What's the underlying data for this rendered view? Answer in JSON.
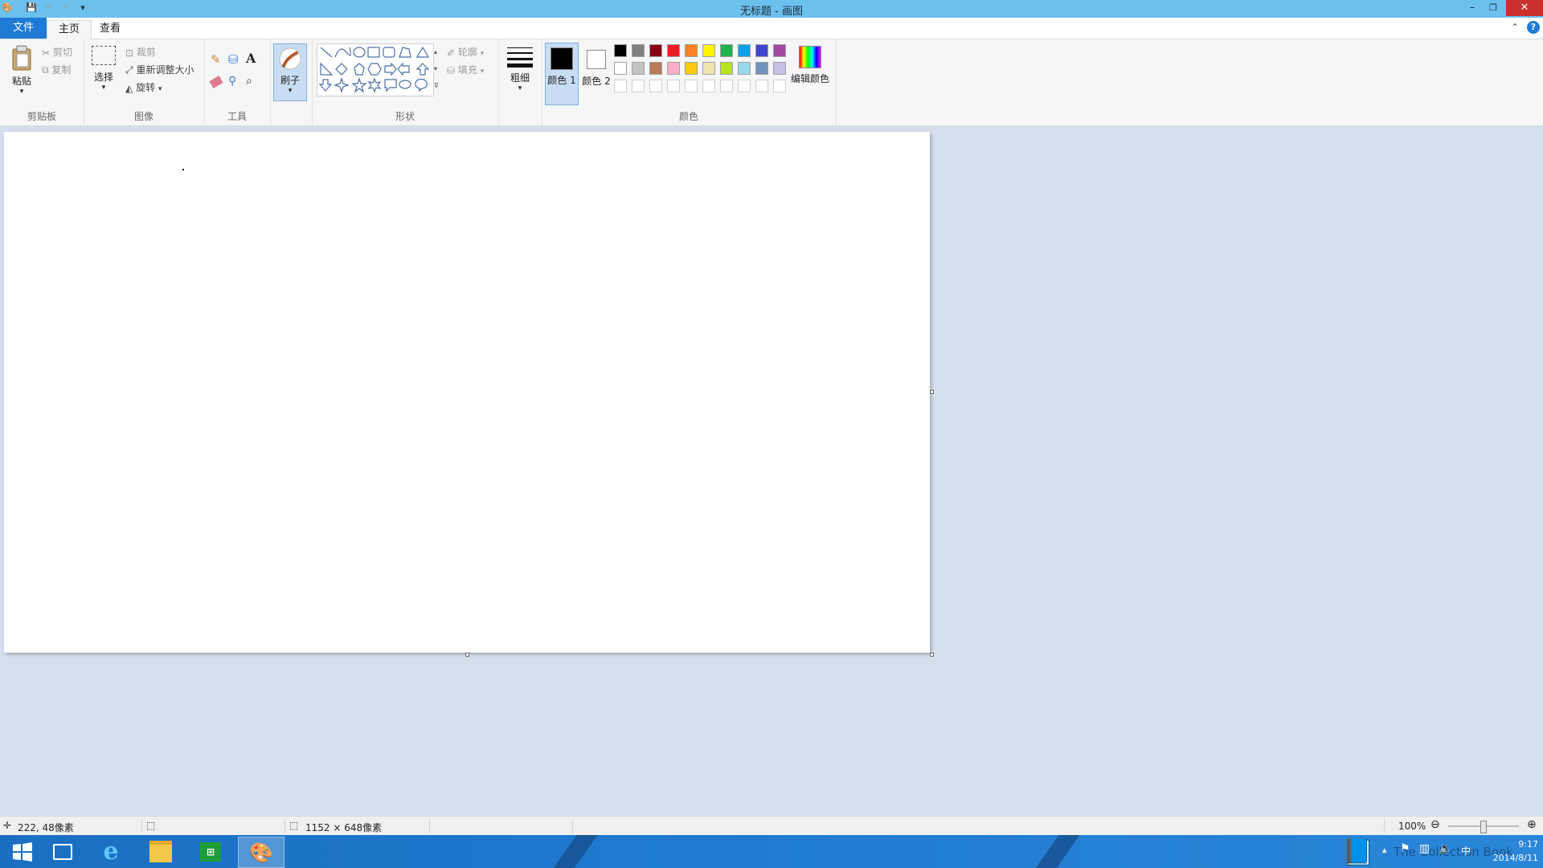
{
  "window": {
    "title": "无标题 - 画图",
    "controls": {
      "minimize": "–",
      "restore": "❐",
      "close": "✕"
    }
  },
  "tabs": [
    {
      "label": "文件"
    },
    {
      "label": "主页"
    },
    {
      "label": "查看"
    }
  ],
  "ribbon": {
    "clipboard": {
      "label": "剪贴板",
      "paste": "粘贴",
      "cut": "剪切",
      "copy": "复制"
    },
    "image": {
      "label": "图像",
      "select": "选择",
      "crop": "裁剪",
      "resize": "重新调整大小",
      "rotate": "旋转"
    },
    "tools": {
      "label": "工具"
    },
    "brushes": {
      "label": "刷子"
    },
    "shapes": {
      "label": "形状",
      "outline": "轮廓",
      "fill": "填充"
    },
    "size": {
      "label": "粗细"
    },
    "colors": {
      "label": "颜色",
      "color1": "颜色 1",
      "color2": "颜色 2",
      "edit": "编辑颜色",
      "palette_row1": [
        "#000000",
        "#7f7f7f",
        "#880015",
        "#ed1c24",
        "#ff7f27",
        "#fff200",
        "#22b14c",
        "#00a2e8",
        "#3f48cc",
        "#a349a4"
      ],
      "palette_row2": [
        "#ffffff",
        "#c3c3c3",
        "#b97a57",
        "#ffaec9",
        "#ffc90e",
        "#efe4b0",
        "#b5e61d",
        "#99d9ea",
        "#7092be",
        "#c8bfe7"
      ]
    }
  },
  "status": {
    "cursor_pos": "222, 48像素",
    "canvas_size": "1152 × 648像素",
    "zoom": "100%"
  },
  "taskbar": {
    "time": "9:17",
    "date": "2014/8/11",
    "ime": "中",
    "watermark": "The Collection Book"
  }
}
